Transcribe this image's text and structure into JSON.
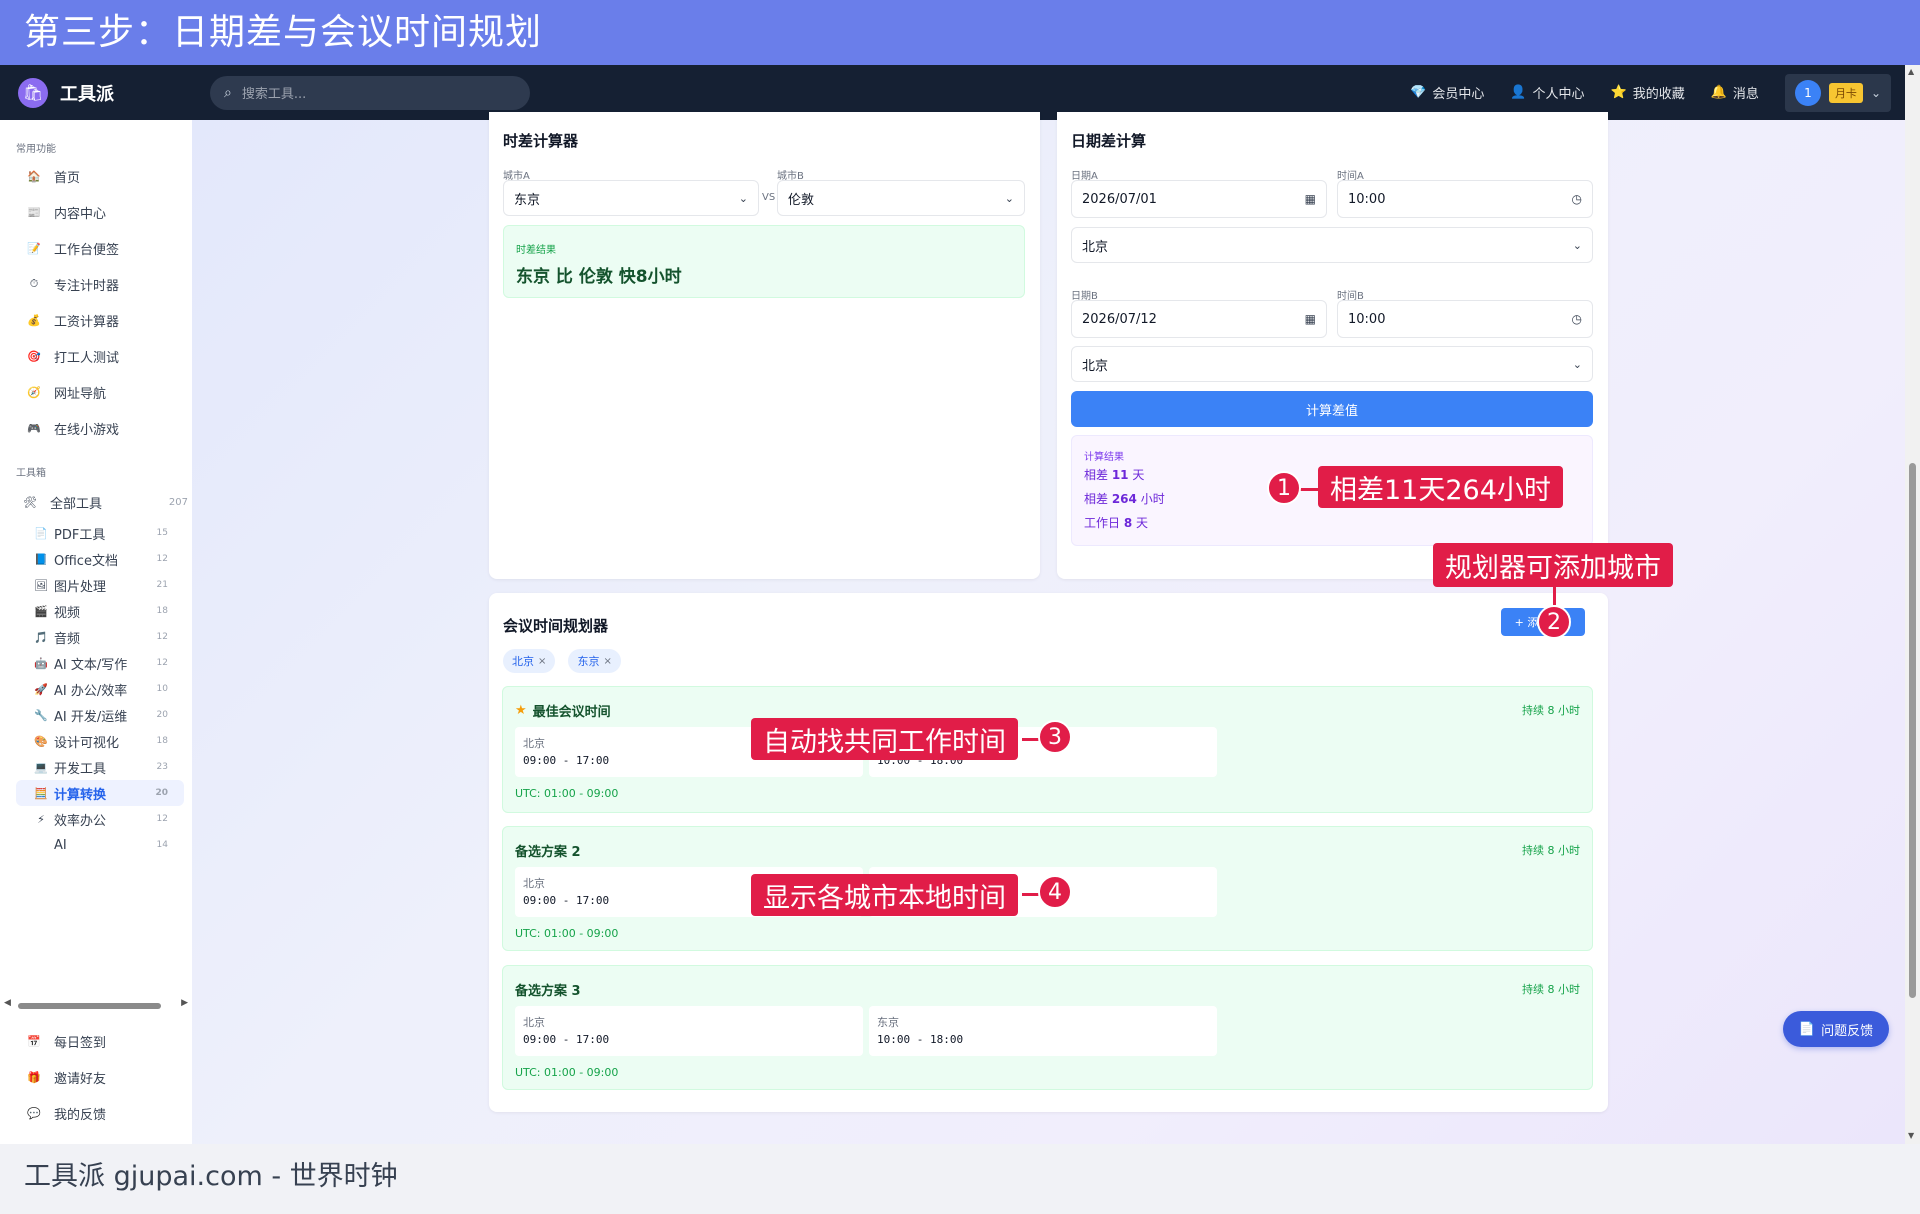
{
  "banner_title": "第三步：日期差与会议时间规划",
  "footer_text": "工具派 gjupai.com - 世界时钟",
  "topbar": {
    "logo_text": "工具派",
    "search_placeholder": "搜索工具...",
    "nav": [
      {
        "icon": "diamond-icon",
        "glyph": "💎",
        "label": "会员中心"
      },
      {
        "icon": "user-icon",
        "glyph": "👤",
        "label": "个人中心"
      },
      {
        "icon": "star-icon",
        "glyph": "⭐",
        "label": "我的收藏"
      },
      {
        "icon": "bell-icon",
        "glyph": "🔔",
        "label": "消息"
      }
    ],
    "avatar_text": "1",
    "vip_badge": "月卡"
  },
  "sidebar": {
    "section_common": "常用功能",
    "common": [
      {
        "icon": "🏠",
        "label": "首页"
      },
      {
        "icon": "📰",
        "label": "内容中心"
      },
      {
        "icon": "📝",
        "label": "工作台便签"
      },
      {
        "icon": "⏱",
        "label": "专注计时器"
      },
      {
        "icon": "💰",
        "label": "工资计算器"
      },
      {
        "icon": "🎯",
        "label": "打工人测试"
      },
      {
        "icon": "🧭",
        "label": "网址导航"
      },
      {
        "icon": "🎮",
        "label": "在线小游戏"
      }
    ],
    "section_toolbox": "工具箱",
    "all_tools": {
      "icon": "🛠",
      "label": "全部工具",
      "count": "207"
    },
    "categories": [
      {
        "icon": "📄",
        "label": "PDF工具",
        "count": "15"
      },
      {
        "icon": "📘",
        "label": "Office文档",
        "count": "12"
      },
      {
        "icon": "🖼",
        "label": "图片处理",
        "count": "21"
      },
      {
        "icon": "🎬",
        "label": "视频",
        "count": "18"
      },
      {
        "icon": "🎵",
        "label": "音频",
        "count": "12"
      },
      {
        "icon": "🤖",
        "label": "AI 文本/写作",
        "count": "12"
      },
      {
        "icon": "🚀",
        "label": "AI 办公/效率",
        "count": "10"
      },
      {
        "icon": "🔧",
        "label": "AI 开发/运维",
        "count": "20"
      },
      {
        "icon": "🎨",
        "label": "设计可视化",
        "count": "18"
      },
      {
        "icon": "💻",
        "label": "开发工具",
        "count": "23"
      },
      {
        "icon": "🧮",
        "label": "计算转换",
        "count": "20",
        "active": true
      },
      {
        "icon": "⚡",
        "label": "效率办公",
        "count": "12"
      },
      {
        "icon": "",
        "label": "AI",
        "count": "14"
      }
    ],
    "bottom": [
      {
        "icon": "📅",
        "label": "每日签到"
      },
      {
        "icon": "🎁",
        "label": "邀请好友"
      },
      {
        "icon": "💬",
        "label": "我的反馈"
      }
    ]
  },
  "tz_card": {
    "title": "时差计算器",
    "city_a_label": "城市A",
    "city_a": "东京",
    "vs": "VS",
    "city_b_label": "城市B",
    "city_b": "伦敦",
    "result_label": "时差结果",
    "result_text": "东京 比 伦敦 快8小时"
  },
  "date_card": {
    "title": "日期差计算",
    "date_a_label": "日期A",
    "date_a": "2026/07/01",
    "time_a_label": "时间A",
    "time_a": "10:00",
    "city_a": "北京",
    "date_b_label": "日期B",
    "date_b": "2026/07/12",
    "time_b_label": "时间B",
    "time_b": "10:00",
    "city_b": "北京",
    "button": "计算差值",
    "result_label": "计算结果",
    "r1_pre": "相差 ",
    "r1_num": "11",
    "r1_unit": " 天",
    "r2_pre": "相差 ",
    "r2_num": "264",
    "r2_unit": " 小时",
    "r3_pre": "工作日 ",
    "r3_num": "8",
    "r3_unit": " 天"
  },
  "meeting_card": {
    "title": "会议时间规划器",
    "add_button": "+ 添加城市",
    "chips": [
      {
        "label": "北京"
      },
      {
        "label": "东京"
      }
    ],
    "plans": [
      {
        "title": "最佳会议时间",
        "duration": "持续 8 小时",
        "cities": [
          {
            "name": "北京",
            "time": "09:00 - 17:00"
          },
          {
            "name": "东京",
            "time": "10:00 - 18:00"
          }
        ],
        "utc": "UTC: 01:00 - 09:00"
      },
      {
        "title": "备选方案 2",
        "duration": "持续 8 小时",
        "cities": [
          {
            "name": "北京",
            "time": "09:00 - 17:00"
          },
          {
            "name": "东京",
            "time": "10:00 - 18:00"
          }
        ],
        "utc": "UTC: 01:00 - 09:00"
      },
      {
        "title": "备选方案 3",
        "duration": "持续 8 小时",
        "cities": [
          {
            "name": "北京",
            "time": "09:00 - 17:00"
          },
          {
            "name": "东京",
            "time": "10:00 - 18:00"
          }
        ],
        "utc": "UTC: 01:00 - 09:00"
      }
    ]
  },
  "annotations": [
    {
      "num": "1",
      "text": "相差11天264小时"
    },
    {
      "num": "2",
      "text": "规划器可添加城市"
    },
    {
      "num": "3",
      "text": "自动找共同工作时间"
    },
    {
      "num": "4",
      "text": "显示各城市本地时间"
    }
  ],
  "feedback_button": "问题反馈",
  "colors": {
    "banner": "#6a7eea",
    "topbar": "#152033",
    "primary": "#3b82f6",
    "callout": "#e11d48",
    "success": "#16a34a"
  }
}
